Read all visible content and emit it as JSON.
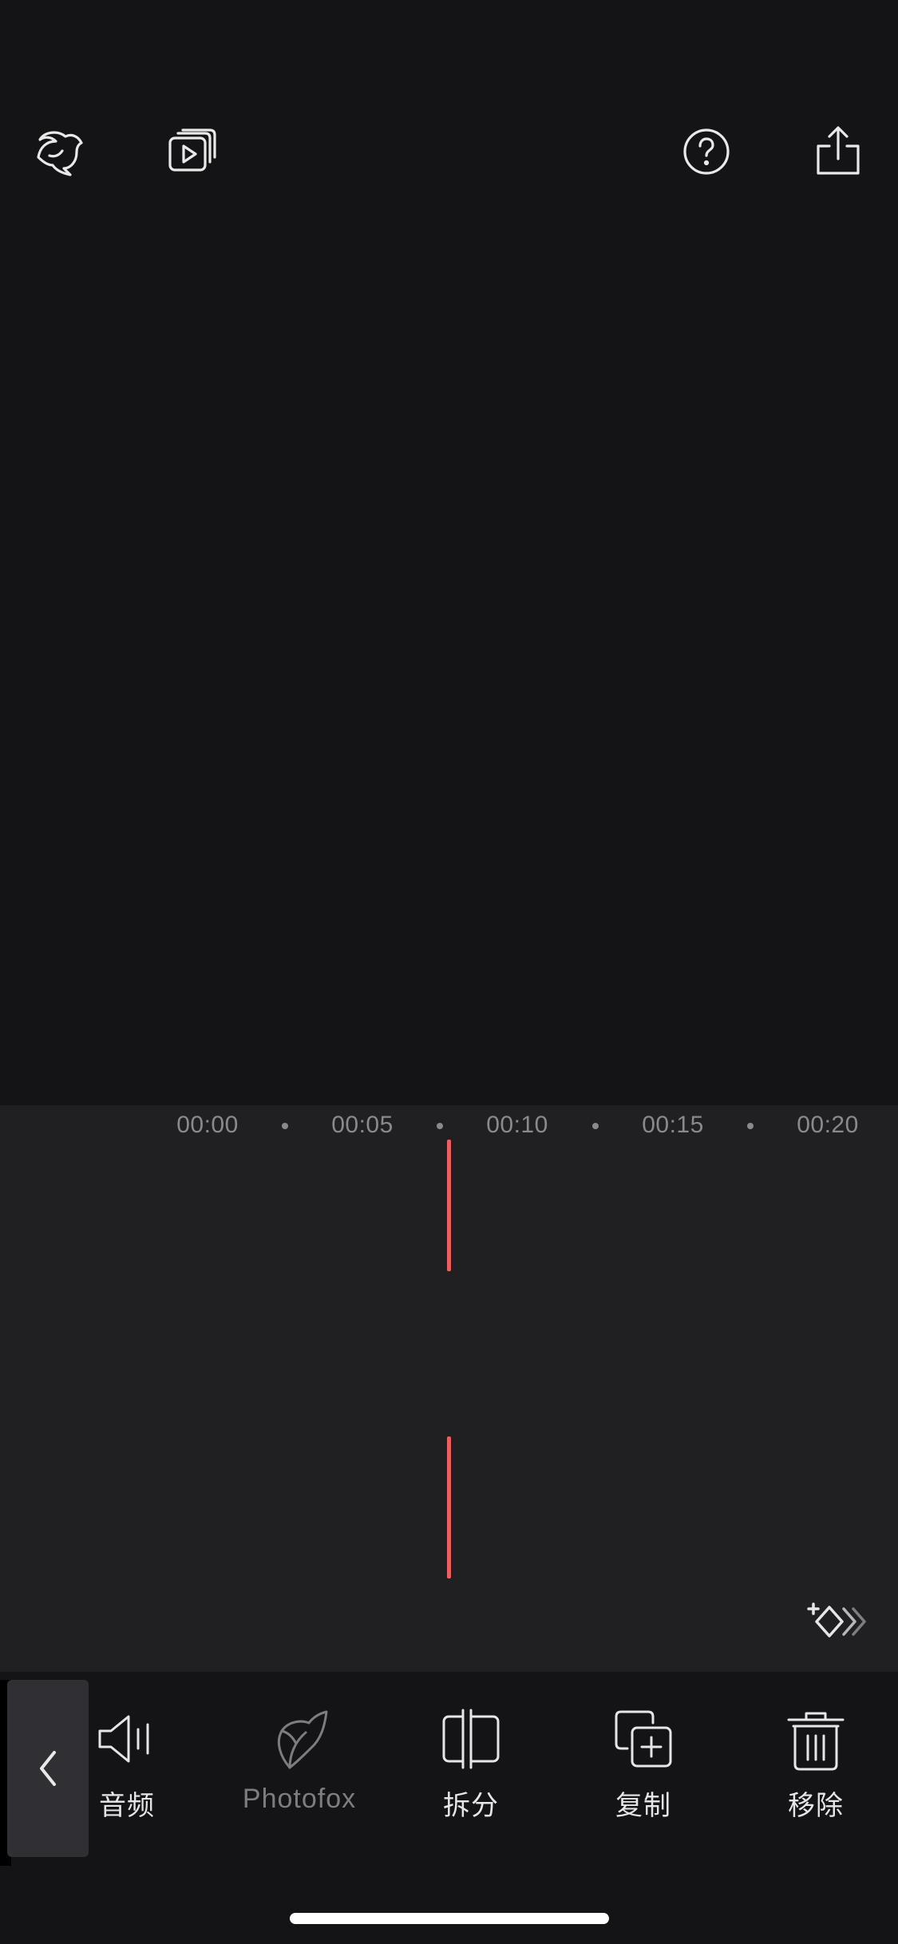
{
  "topbar": {
    "icons": [
      "photofox-logo-icon",
      "play-stack-icon",
      "help-icon",
      "share-icon"
    ]
  },
  "timeline": {
    "ruler_labels": [
      "00:00",
      "00:05",
      "00:10",
      "00:15",
      "00:20"
    ]
  },
  "toolbar": {
    "audio_label": "音频",
    "photofox_label": "Photofox",
    "split_label": "拆分",
    "copy_label": "复制",
    "remove_label": "移除"
  },
  "colors": {
    "background": "#141416",
    "timeline": "#202022",
    "playhead": "#ef5e5e",
    "text": "#e6e6e8",
    "muted": "#8a8a8e"
  }
}
